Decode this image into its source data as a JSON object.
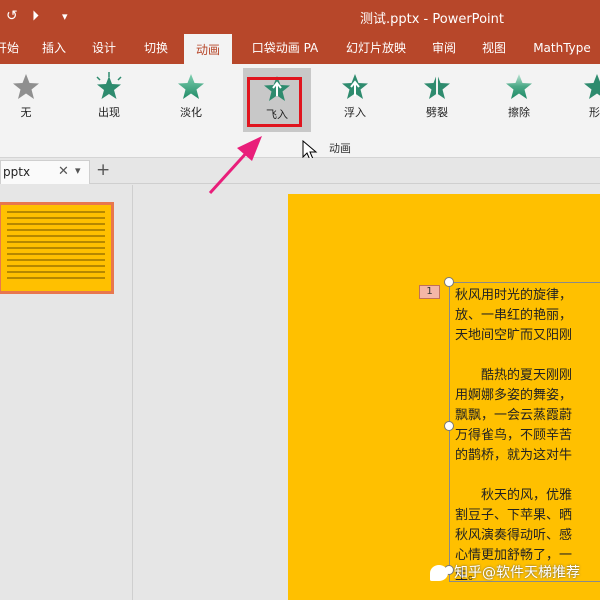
{
  "title_bar": {
    "title": "测试.pptx  -  PowerPoint",
    "quick_access": [
      "↺",
      "⏵",
      "▾"
    ]
  },
  "ribbon_tabs": [
    {
      "label": "开始",
      "active": false
    },
    {
      "label": "插入",
      "active": false
    },
    {
      "label": "设计",
      "active": false
    },
    {
      "label": "切换",
      "active": false
    },
    {
      "label": "动画",
      "active": true
    },
    {
      "label": "口袋动画 PA",
      "active": false
    },
    {
      "label": "幻灯片放映",
      "active": false
    },
    {
      "label": "审阅",
      "active": false
    },
    {
      "label": "视图",
      "active": false
    },
    {
      "label": "MathType",
      "active": false
    }
  ],
  "animations": [
    {
      "label": "无",
      "icon": "star-gray-icon",
      "selected": false
    },
    {
      "label": "出现",
      "icon": "star-burst-icon",
      "selected": false
    },
    {
      "label": "淡化",
      "icon": "star-fade-icon",
      "selected": false
    },
    {
      "label": "飞入",
      "icon": "star-fly-in-icon",
      "selected": true
    },
    {
      "label": "浮入",
      "icon": "star-float-in-icon",
      "selected": false
    },
    {
      "label": "劈裂",
      "icon": "star-split-icon",
      "selected": false
    },
    {
      "label": "擦除",
      "icon": "star-wipe-icon",
      "selected": false
    },
    {
      "label": "形",
      "icon": "star-shape-icon",
      "selected": false
    }
  ],
  "ribbon_group_label": "动画",
  "file_tab": {
    "name": "pptx",
    "close": "✕",
    "more": "▾",
    "add": "+"
  },
  "slide": {
    "animation_badge": "1",
    "paragraphs": [
      [
        "秋风用时光的旋律，",
        "放、一串红的艳丽，",
        "天地间空旷而又阳刚"
      ],
      [
        "　　酷热的夏天刚刚",
        "用婀娜多姿的舞姿，",
        "飘飘，一会云蒸霞蔚",
        "万得雀鸟，不顾辛苦",
        "的鹊桥，就为这对牛"
      ],
      [
        "　　秋天的风，优雅",
        "割豆子、下苹果、晒",
        "秋风演奏得动听、感",
        "心情更加舒畅了，一",
        "生。"
      ]
    ]
  },
  "watermark": "知乎@软件天梯推荐",
  "colors": {
    "brand": "#b7472a",
    "slide_background": "#ffc000",
    "highlight": "#e0141e",
    "arrow": "#e91e7a",
    "thumbnail_border": "#e8774e"
  }
}
